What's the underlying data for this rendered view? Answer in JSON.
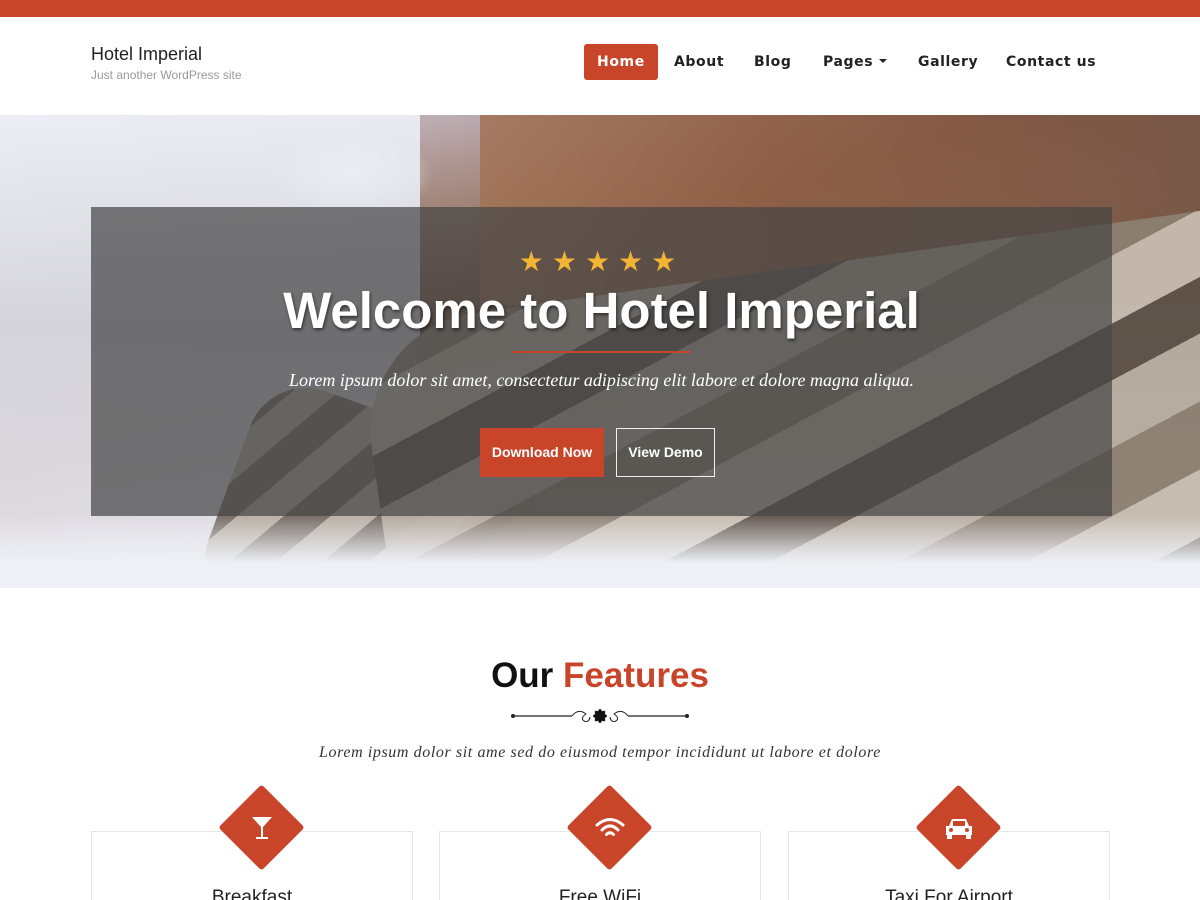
{
  "site": {
    "title": "Hotel Imperial",
    "tagline": "Just another WordPress site"
  },
  "nav": {
    "items": [
      {
        "label": "Home",
        "active": true
      },
      {
        "label": "About"
      },
      {
        "label": "Blog"
      },
      {
        "label": "Pages",
        "has_dropdown": true
      },
      {
        "label": "Gallery"
      },
      {
        "label": "Contact us"
      }
    ]
  },
  "hero": {
    "rating_stars": 5,
    "title": "Welcome to Hotel Imperial",
    "subtitle": "Lorem ipsum dolor sit amet, consectetur adipiscing elit labore et dolore magna aliqua.",
    "primary_button": "Download Now",
    "secondary_button": "View Demo"
  },
  "features": {
    "title_plain": "Our",
    "title_accent": "Features",
    "subtitle": "Lorem ipsum dolor sit ame sed do eiusmod tempor incididunt ut labore et dolore",
    "cards": [
      {
        "title": "Breakfast",
        "icon": "cocktail-glass-icon"
      },
      {
        "title": "Free WiFi",
        "icon": "wifi-icon"
      },
      {
        "title": "Taxi For Airport",
        "icon": "car-icon"
      }
    ]
  },
  "colors": {
    "accent": "#c9452a",
    "star": "#f3b334",
    "text_dark": "#222222"
  }
}
